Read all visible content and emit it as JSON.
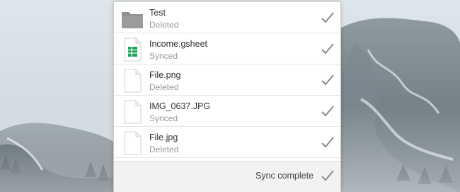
{
  "files": [
    {
      "name": "Test",
      "status": "Deleted",
      "icon": "folder-icon"
    },
    {
      "name": "Income.gsheet",
      "status": "Synced",
      "icon": "spreadsheet-icon"
    },
    {
      "name": "File.png",
      "status": "Deleted",
      "icon": "document-icon"
    },
    {
      "name": "IMG_0637.JPG",
      "status": "Synced",
      "icon": "document-icon"
    },
    {
      "name": "File.jpg",
      "status": "Deleted",
      "icon": "document-icon"
    }
  ],
  "footer": {
    "status_text": "Sync complete",
    "icon": "checkmark-icon"
  },
  "colors": {
    "check": "#8c8c8c",
    "folder": "#8e8e8e",
    "sheet_green": "#1e9e57"
  }
}
